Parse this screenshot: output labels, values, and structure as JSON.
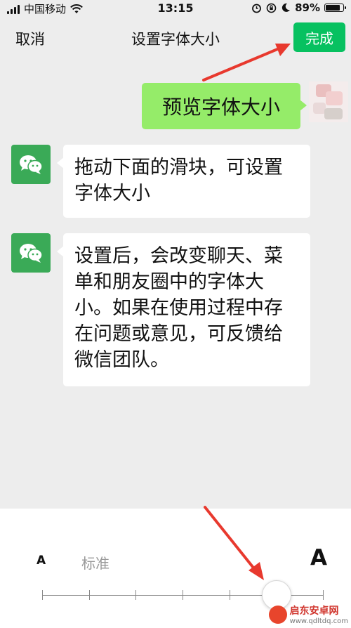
{
  "status_bar": {
    "carrier": "中国移动",
    "time": "13:15",
    "battery_percent": "89%",
    "battery_level": 0.89,
    "icons": [
      "signal-icon",
      "wifi-icon",
      "alarm-icon",
      "orientation-lock-icon",
      "moon-icon",
      "battery-icon"
    ]
  },
  "nav": {
    "cancel_label": "取消",
    "title": "设置字体大小",
    "done_label": "完成"
  },
  "messages": [
    {
      "side": "right",
      "text": "预览字体大小"
    },
    {
      "side": "left",
      "text": "拖动下面的滑块，可设置字体大小"
    },
    {
      "side": "left",
      "text": "设置后，会改变聊天、菜单和朋友圈中的字体大小。如果在使用过程中存在问题或意见，可反馈给微信团队。"
    }
  ],
  "font_slider": {
    "small_label": "A",
    "standard_label": "标准",
    "large_label": "A",
    "steps": 7,
    "selected_step": 5
  },
  "watermark": {
    "title": "启东安卓网",
    "url": "www.qdltdq.com"
  },
  "colors": {
    "background": "#ededed",
    "accent_green": "#07c160",
    "bubble_green": "#95ec69",
    "annotation_red": "#e8392e"
  }
}
